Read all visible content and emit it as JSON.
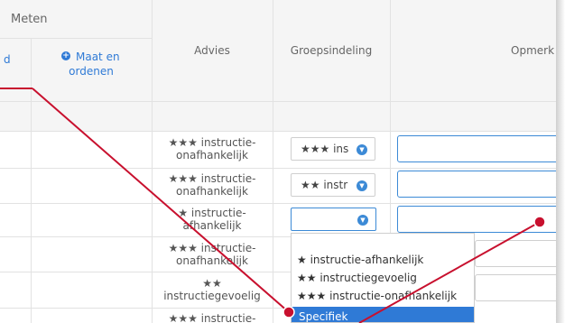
{
  "table": {
    "header": {
      "meten": "Meten",
      "partial_left": "d",
      "maat_en_ordenen": [
        "Maat en",
        "ordenen"
      ],
      "advies": "Advies",
      "groepsindeling": "Groepsindeling",
      "opmerkingen_partial": "Opmerk"
    },
    "rows": [
      {
        "advies": [
          "★★★ instructie-",
          "onafhankelijk"
        ],
        "groep": "★★★ ins"
      },
      {
        "advies": [
          "★★★ instructie-",
          "onafhankelijk"
        ],
        "groep": "★★ instr"
      },
      {
        "advies": [
          "★ instructie-",
          "afhankelijk"
        ],
        "groep": ""
      },
      {
        "advies": [
          "★★★ instructie-",
          "onafhankelijk"
        ],
        "groep": ""
      },
      {
        "advies": [
          "★★",
          "instructiegevoelig"
        ],
        "groep": ""
      },
      {
        "advies": [
          "★★★ instructie-"
        ],
        "groep": ""
      }
    ]
  },
  "dropdown": {
    "options": [
      "★ instructie-afhankelijk",
      "★★ instructiegevoelig",
      "★★★ instructie-onafhankelijk",
      "Specifiek"
    ],
    "highlighted": "Specifiek"
  },
  "colors": {
    "accent": "#2f7ad6",
    "annotation": "#c8102e"
  },
  "icons": {
    "plus": "plus-circle-icon",
    "chevron": "chevron-down-icon"
  }
}
